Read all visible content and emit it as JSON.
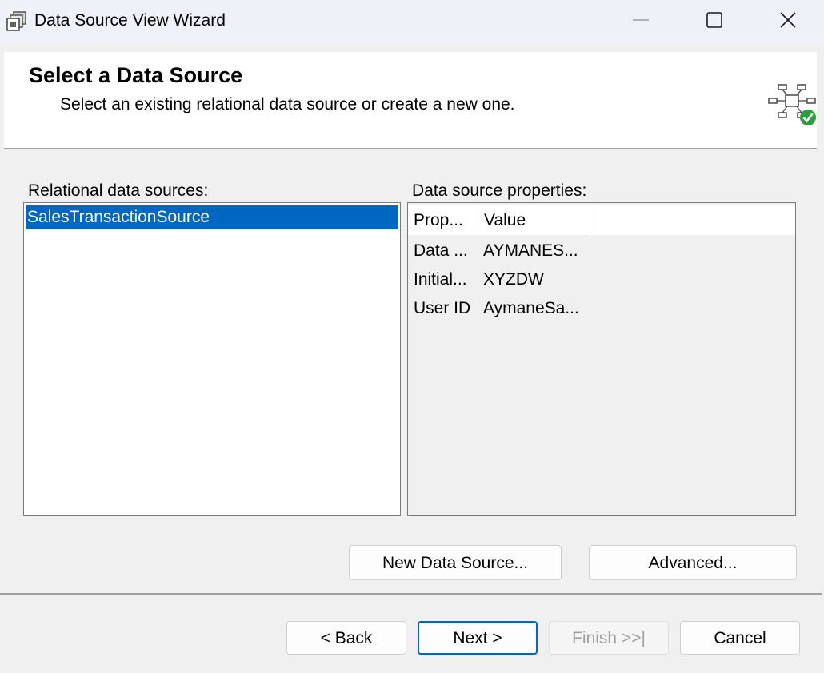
{
  "window": {
    "title": "Data Source View Wizard",
    "icons": {
      "app": "data-source-view-icon",
      "minimize": "minimize-icon",
      "maximize": "maximize-icon",
      "close": "close-icon"
    }
  },
  "header": {
    "title": "Select a Data Source",
    "subtitle": "Select an existing relational data source or create a new one.",
    "icon": "data-source-network-check-icon"
  },
  "sources": {
    "label": "Relational data sources:",
    "items": [
      "SalesTransactionSource"
    ],
    "selected": "SalesTransactionSource"
  },
  "properties": {
    "label": "Data source properties:",
    "columns": [
      "Prop...",
      "Value"
    ],
    "rows": [
      {
        "prop": "Data ...",
        "value": "AYMANES..."
      },
      {
        "prop": "Initial...",
        "value": "XYZDW"
      },
      {
        "prop": "User ID",
        "value": "AymaneSa..."
      }
    ]
  },
  "buttons": {
    "new_source": "New Data Source...",
    "advanced": "Advanced...",
    "back": "< Back",
    "next": "Next >",
    "finish": "Finish >>|",
    "cancel": "Cancel"
  },
  "colors": {
    "selection": "#0067c0",
    "check": "#2e9d3f",
    "disabled_text": "#a0a0a0"
  }
}
